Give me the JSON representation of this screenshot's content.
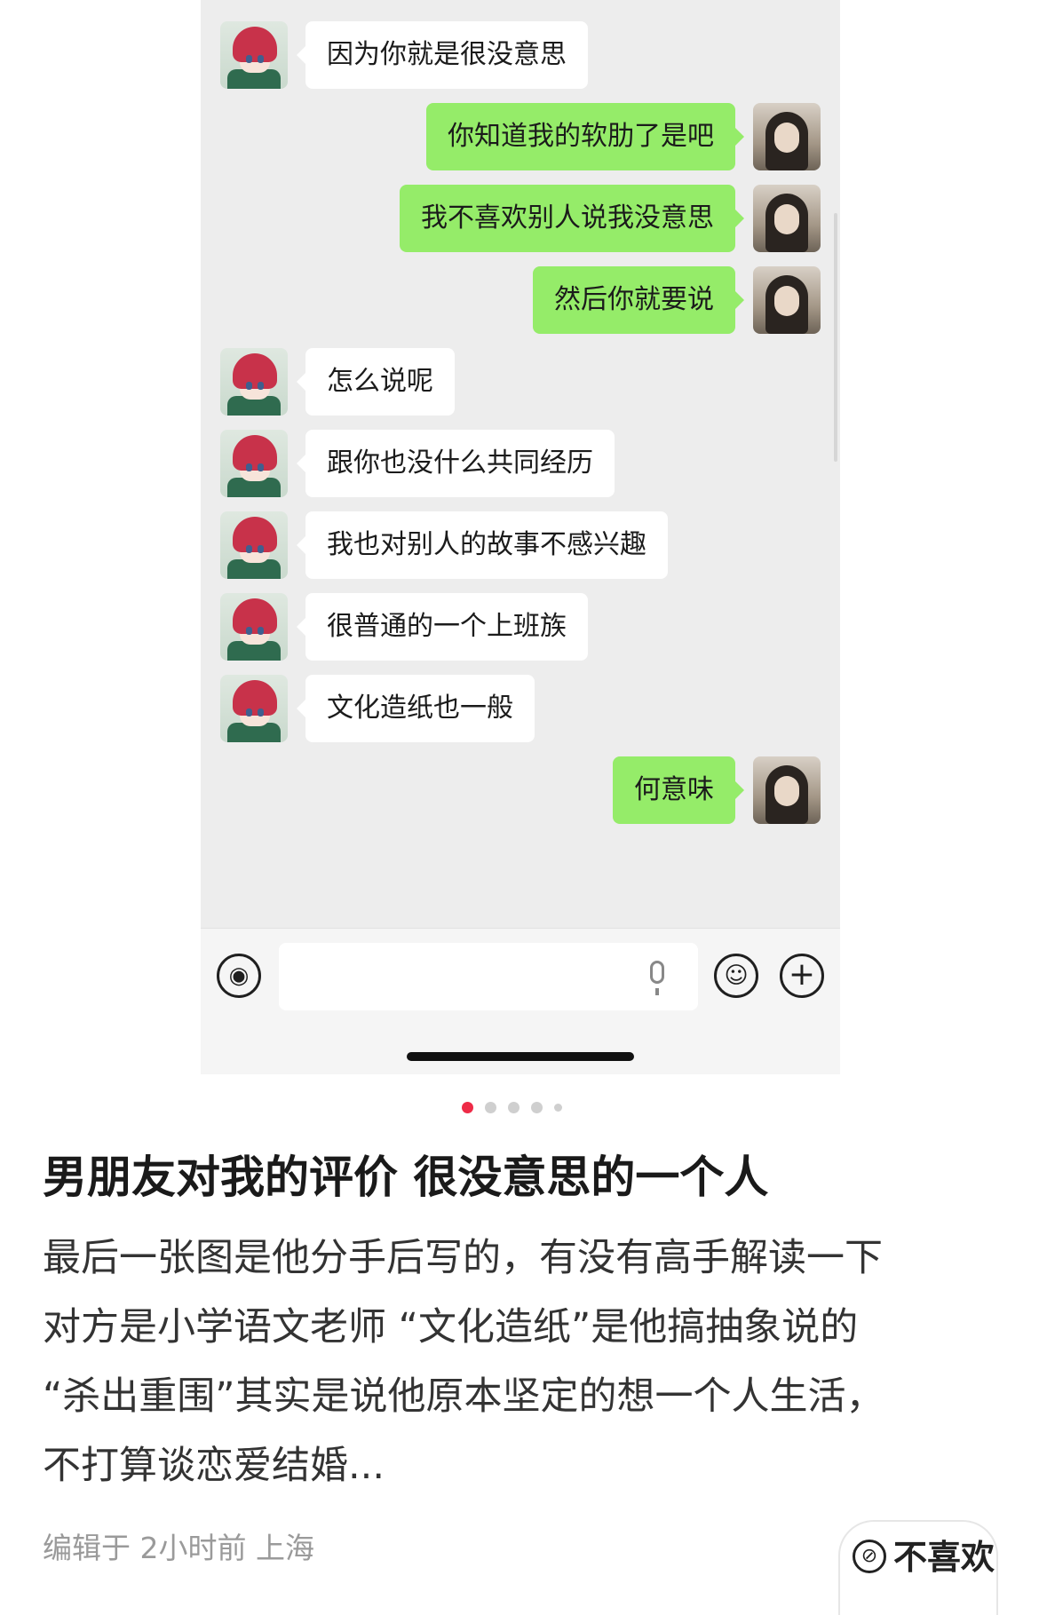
{
  "chat": {
    "messages": [
      {
        "side": "in",
        "text": "因为你就是很没意思"
      },
      {
        "side": "out",
        "text": "你知道我的软肋了是吧"
      },
      {
        "side": "out",
        "text": "我不喜欢别人说我没意思"
      },
      {
        "side": "out",
        "text": "然后你就要说"
      },
      {
        "side": "in",
        "text": "怎么说呢"
      },
      {
        "side": "in",
        "text": "跟你也没什么共同经历"
      },
      {
        "side": "in",
        "text": "我也对别人的故事不感兴趣"
      },
      {
        "side": "in",
        "text": "很普通的一个上班族"
      },
      {
        "side": "in",
        "text": "文化造纸也一般"
      },
      {
        "side": "out",
        "text": "何意味"
      }
    ],
    "colors": {
      "outgoing_bubble": "#95ec69",
      "incoming_bubble": "#ffffff",
      "background": "#ededed"
    }
  },
  "input_bar": {
    "voice_icon": "voice-wave-icon",
    "mic_icon": "microphone-icon",
    "emoji_icon": "smiley-icon",
    "plus_icon": "plus-icon"
  },
  "pager": {
    "count": 5,
    "active": 1,
    "active_color": "#ee2b47"
  },
  "post": {
    "title": "男朋友对我的评价 很没意思的一个人",
    "body_lines": [
      "最后一张图是他分手后写的，有没有高手解读一下",
      "对方是小学语文老师 “文化造纸”是他搞抽象说的",
      "“杀出重围”其实是说他原本坚定的想一个人生活，",
      "不打算谈恋爱结婚..."
    ],
    "meta": "编辑于 2小时前 上海",
    "dislike_label": "不喜欢"
  }
}
